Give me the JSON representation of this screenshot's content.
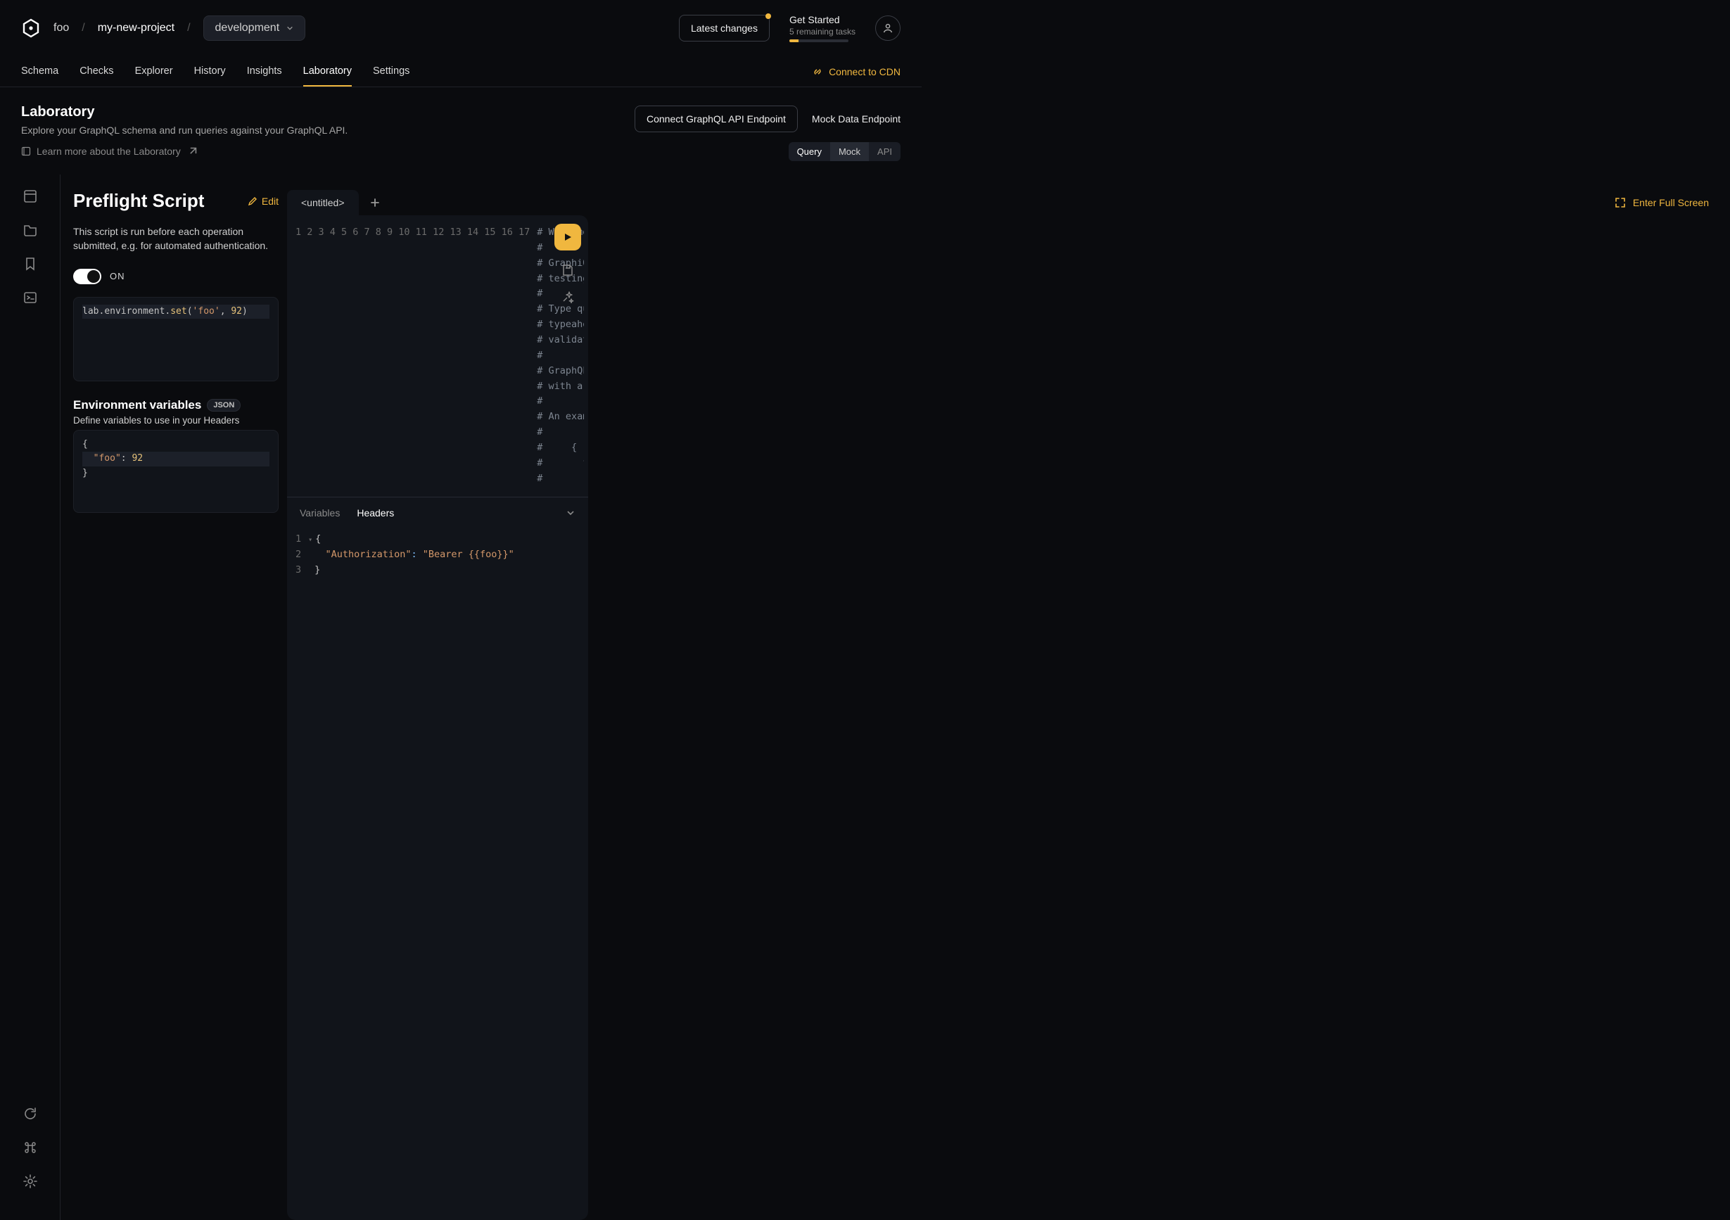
{
  "breadcrumbs": {
    "org": "foo",
    "project": "my-new-project",
    "env": "development"
  },
  "top": {
    "latest": "Latest changes",
    "getstarted": {
      "title": "Get Started",
      "sub": "5 remaining tasks"
    }
  },
  "tabs": {
    "schema": "Schema",
    "checks": "Checks",
    "explorer": "Explorer",
    "history": "History",
    "insights": "Insights",
    "laboratory": "Laboratory",
    "settings": "Settings",
    "cdn": "Connect to CDN"
  },
  "page": {
    "title": "Laboratory",
    "subtitle": "Explore your GraphQL schema and run queries against your GraphQL API.",
    "learn": "Learn more about the Laboratory",
    "connect_api": "Connect GraphQL API Endpoint",
    "mock_endpoint": "Mock Data Endpoint",
    "seg": {
      "query": "Query",
      "mock": "Mock",
      "api": "API"
    }
  },
  "preflight": {
    "title": "Preflight Script",
    "edit": "Edit",
    "desc": "This script is run before each operation submitted, e.g. for automated authentication.",
    "toggle": "ON"
  },
  "preflight_code": {
    "obj": "lab",
    "prop": "environment",
    "fn": "set",
    "arg1": "'foo'",
    "arg2": "92"
  },
  "env": {
    "title": "Environment variables",
    "badge": "JSON",
    "sub": "Define variables to use in your Headers"
  },
  "env_code": {
    "key": "\"foo\"",
    "val": "92"
  },
  "editor": {
    "tab": "<untitled>",
    "fullscreen": "Enter Full Screen",
    "lines": [
      "# Welcome to GraphiQL",
      "#",
      "# GraphiQL is an in-browser tool fo",
      "# testing GraphQL queries.",
      "#",
      "# Type queries into this side of th",
      "# typeaheads aware of the current G",
      "# validation errors highlighted wit",
      "#",
      "# GraphQL queries typically start w",
      "# with a # are ignored.",
      "#",
      "# An example GraphQL query might lo",
      "#",
      "#     {",
      "#       field(arg: \"value\") {",
      "#         subField"
    ],
    "bottom": {
      "variables": "Variables",
      "headers": "Headers",
      "hkey": "\"Authorization\"",
      "hval": "\"Bearer {{foo}}\""
    }
  }
}
